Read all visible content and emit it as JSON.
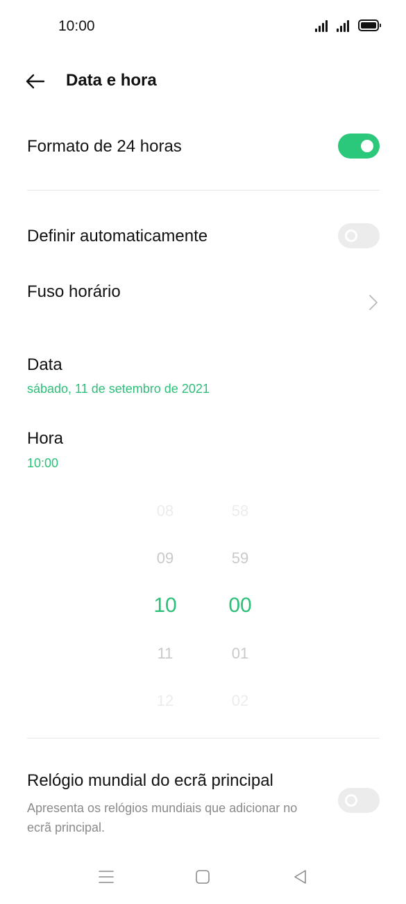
{
  "status_bar": {
    "time": "10:00"
  },
  "header": {
    "title": "Data e hora"
  },
  "settings": {
    "format_24h": {
      "label": "Formato de 24 horas",
      "enabled": true
    },
    "auto_set": {
      "label": "Definir automaticamente",
      "enabled": false
    },
    "timezone": {
      "label": "Fuso horário"
    },
    "date": {
      "label": "Data",
      "value": "sábado, 11 de setembro de 2021"
    },
    "time": {
      "label": "Hora",
      "value": "10:00"
    }
  },
  "time_picker": {
    "hours": [
      "08",
      "09",
      "10",
      "11",
      "12"
    ],
    "minutes": [
      "58",
      "59",
      "00",
      "01",
      "02"
    ],
    "selected_index": 2
  },
  "world_clock": {
    "label": "Relógio mundial do ecrã principal",
    "description": "Apresenta os relógios mundiais que adicionar no ecrã principal.",
    "enabled": false
  },
  "colors": {
    "accent": "#2bbf78",
    "toggle_on": "#2bc77a",
    "toggle_off": "#ececec"
  },
  "icons": {
    "back": "arrow-left-icon",
    "chevron": "chevron-right-icon",
    "nav_menu": "menu-icon",
    "nav_home": "home-icon",
    "nav_back": "back-triangle-icon"
  }
}
